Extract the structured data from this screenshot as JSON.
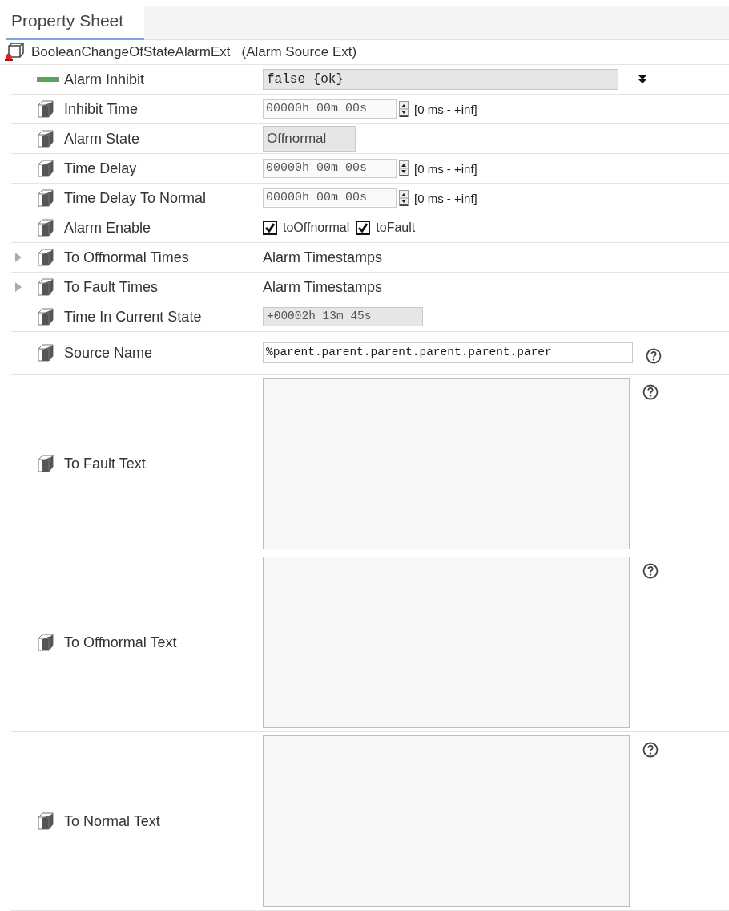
{
  "tab": {
    "label": "Property Sheet",
    "selected": true
  },
  "component": {
    "name": "BooleanChangeOfStateAlarmExt",
    "type": "(Alarm Source Ext)"
  },
  "properties": [
    {
      "kind": "enum",
      "label": "Alarm Inhibit",
      "value": "false {ok}"
    },
    {
      "kind": "duration",
      "label": "Inhibit Time",
      "value": "00000h 00m 00s",
      "range": "[0 ms - +inf]"
    },
    {
      "kind": "readonly",
      "label": "Alarm State",
      "value": "Offnormal"
    },
    {
      "kind": "duration",
      "label": "Time Delay",
      "value": "00000h 00m 00s",
      "range": "[0 ms - +inf]"
    },
    {
      "kind": "duration",
      "label": "Time Delay To Normal",
      "value": "00000h 00m 00s",
      "range": "[0 ms - +inf]"
    },
    {
      "kind": "flags",
      "label": "Alarm Enable",
      "options": [
        {
          "label": "toOffnormal",
          "checked": true
        },
        {
          "label": "toFault",
          "checked": true
        }
      ]
    },
    {
      "kind": "struct",
      "label": "To Offnormal Times",
      "value": "Alarm Timestamps",
      "expanded": false
    },
    {
      "kind": "struct",
      "label": "To Fault Times",
      "value": "Alarm Timestamps",
      "expanded": false
    },
    {
      "kind": "readonly-mono",
      "label": "Time In Current State",
      "value": "+00002h 13m 45s"
    },
    {
      "kind": "text",
      "label": "Source Name",
      "value": "%parent.parent.parent.parent.parent.parer"
    },
    {
      "kind": "textarea",
      "label": "To Fault Text"
    },
    {
      "kind": "textarea",
      "label": "To Offnormal Text"
    },
    {
      "kind": "textarea",
      "label": "To Normal Text"
    }
  ]
}
